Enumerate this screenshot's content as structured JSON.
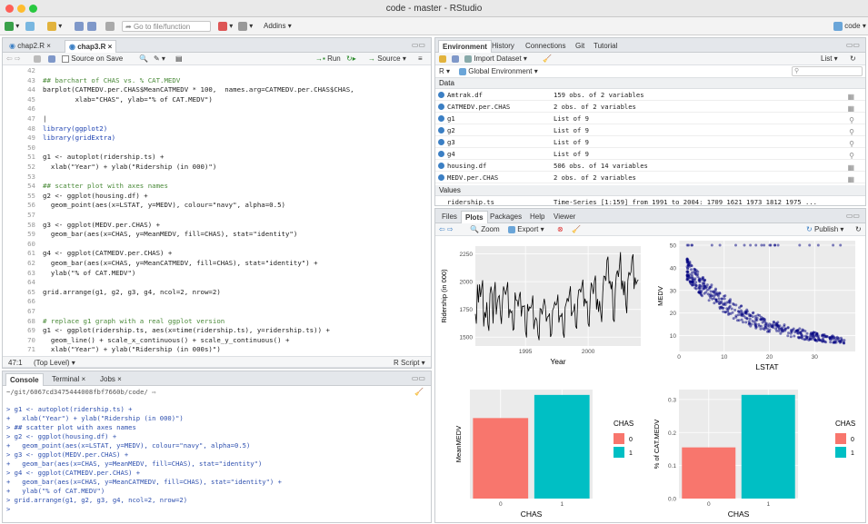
{
  "window": {
    "title": "code - master - RStudio"
  },
  "toolbar": {
    "goto_placeholder": "Go to file/function",
    "addins": "Addins",
    "project": "code"
  },
  "editor": {
    "tabs": [
      "chap2.R",
      "chap3.R"
    ],
    "source_on_save": "Source on Save",
    "run": "Run",
    "source": "Source",
    "status_pos": "47:1",
    "status_level": "(Top Level)",
    "status_type": "R Script",
    "lines": [
      {
        "n": "42",
        "t": ""
      },
      {
        "n": "43",
        "t": "## barchart of CHAS vs. % CAT.MEDV"
      },
      {
        "n": "44",
        "t": "barplot(CATMEDV.per.CHAS$MeanCATMEDV * 100,  names.arg=CATMEDV.per.CHAS$CHAS,"
      },
      {
        "n": "45",
        "t": "        xlab=\"CHAS\", ylab=\"% of CAT.MEDV\")"
      },
      {
        "n": "46",
        "t": ""
      },
      {
        "n": "47",
        "t": "|"
      },
      {
        "n": "48",
        "t": "library(ggplot2)"
      },
      {
        "n": "49",
        "t": "library(gridExtra)"
      },
      {
        "n": "50",
        "t": ""
      },
      {
        "n": "51",
        "t": "g1 <- autoplot(ridership.ts) +"
      },
      {
        "n": "52",
        "t": "  xlab(\"Year\") + ylab(\"Ridership (in 000)\")"
      },
      {
        "n": "53",
        "t": ""
      },
      {
        "n": "54",
        "t": "## scatter plot with axes names"
      },
      {
        "n": "55",
        "t": "g2 <- ggplot(housing.df) +"
      },
      {
        "n": "56",
        "t": "  geom_point(aes(x=LSTAT, y=MEDV), colour=\"navy\", alpha=0.5)"
      },
      {
        "n": "57",
        "t": ""
      },
      {
        "n": "58",
        "t": "g3 <- ggplot(MEDV.per.CHAS) +"
      },
      {
        "n": "59",
        "t": "  geom_bar(aes(x=CHAS, y=MeanMEDV, fill=CHAS), stat=\"identity\")"
      },
      {
        "n": "60",
        "t": ""
      },
      {
        "n": "61",
        "t": "g4 <- ggplot(CATMEDV.per.CHAS) +"
      },
      {
        "n": "62",
        "t": "  geom_bar(aes(x=CHAS, y=MeanCATMEDV, fill=CHAS), stat=\"identity\") +"
      },
      {
        "n": "63",
        "t": "  ylab(\"% of CAT.MEDV\")"
      },
      {
        "n": "64",
        "t": ""
      },
      {
        "n": "65",
        "t": "grid.arrange(g1, g2, g3, g4, ncol=2, nrow=2)"
      },
      {
        "n": "66",
        "t": ""
      },
      {
        "n": "67",
        "t": ""
      },
      {
        "n": "68",
        "t": "# replace g1 graph with a real ggplot version"
      },
      {
        "n": "69",
        "t": "g1 <- ggplot(ridership.ts, aes(x=time(ridership.ts), y=ridership.ts)) +"
      },
      {
        "n": "70",
        "t": "  geom_line() + scale_x_continuous() + scale_y_continuous() +"
      },
      {
        "n": "71",
        "t": "  xlab(\"Year\") + ylab(\"Ridership (in 000s)\")"
      }
    ]
  },
  "console": {
    "tabs": [
      "Console",
      "Terminal",
      "Jobs"
    ],
    "path": "~/git/6067cd3475444008fbf7660b/code/",
    "lines": [
      "> g1 <- autoplot(ridership.ts) +",
      "+   xlab(\"Year\") + ylab(\"Ridership (in 000)\")",
      "> ## scatter plot with axes names",
      "> g2 <- ggplot(housing.df) +",
      "+   geom_point(aes(x=LSTAT, y=MEDV), colour=\"navy\", alpha=0.5)",
      "> g3 <- ggplot(MEDV.per.CHAS) +",
      "+   geom_bar(aes(x=CHAS, y=MeanMEDV, fill=CHAS), stat=\"identity\")",
      "> g4 <- ggplot(CATMEDV.per.CHAS) +",
      "+   geom_bar(aes(x=CHAS, y=MeanCATMEDV, fill=CHAS), stat=\"identity\") +",
      "+   ylab(\"% of CAT.MEDV\")",
      "> grid.arrange(g1, g2, g3, g4, ncol=2, nrow=2)",
      ">"
    ]
  },
  "environment": {
    "tabs": [
      "Environment",
      "History",
      "Connections",
      "Git",
      "Tutorial"
    ],
    "import_dataset": "Import Dataset",
    "list_view": "List",
    "lang": "R",
    "scope": "Global Environment",
    "data_header": "Data",
    "values_header": "Values",
    "rows": [
      {
        "name": "Amtrak.df",
        "value": "159 obs. of 2 variables"
      },
      {
        "name": "CATMEDV.per.CHAS",
        "value": "2 obs. of 2 variables"
      },
      {
        "name": "g1",
        "value": "List of  9"
      },
      {
        "name": "g2",
        "value": "List of  9"
      },
      {
        "name": "g3",
        "value": "List of  9"
      },
      {
        "name": "g4",
        "value": "List of  9"
      },
      {
        "name": "housing.df",
        "value": "506 obs. of 14 variables"
      },
      {
        "name": "MEDV.per.CHAS",
        "value": "2 obs. of 2 variables"
      }
    ],
    "values_row": {
      "name": "ridership.ts",
      "value": "Time-Series [1:159] from 1991 to 2004: 1709 1621 1973 1812 1975 ..."
    }
  },
  "plots_pane": {
    "tabs": [
      "Files",
      "Plots",
      "Packages",
      "Help",
      "Viewer"
    ],
    "zoom": "Zoom",
    "export": "Export",
    "publish": "Publish"
  },
  "colors": {
    "chas0": "#F8766D",
    "chas1": "#00BFC4",
    "navy": "#000080"
  },
  "chart_data": [
    {
      "type": "line",
      "xlabel": "Year",
      "ylabel": "Ridership (in 000)",
      "xlim": [
        1991,
        2004.2
      ],
      "ylim": [
        1420,
        2320
      ],
      "xticks": [
        1995,
        2000
      ],
      "yticks": [
        1500,
        1750,
        2000,
        2250
      ],
      "start": 1991,
      "frequency": 12,
      "values": [
        1709,
        1621,
        1973,
        1812,
        1975,
        1862,
        1940,
        2013,
        1596,
        1725,
        1676,
        1814,
        1615,
        1557,
        1891,
        1956,
        1885,
        1623,
        1903,
        1997,
        1704,
        1810,
        1862,
        1875,
        1705,
        1619,
        1837,
        1957,
        1917,
        1882,
        1933,
        1996,
        1673,
        1753,
        1720,
        1734,
        1563,
        1574,
        1903,
        1834,
        1831,
        1776,
        1868,
        1907,
        1686,
        1779,
        1776,
        1783,
        1548,
        1497,
        1798,
        1733,
        1772,
        1761,
        1792,
        1875,
        1571,
        1647,
        1673,
        1646,
        1521,
        1472,
        1758,
        1751,
        1704,
        1785,
        1846,
        1779,
        1640,
        1682,
        1688,
        1713,
        1502,
        1528,
        1742,
        1765,
        1814,
        1788,
        1799,
        1883,
        1631,
        1693,
        1686,
        1716,
        1538,
        1495,
        1769,
        1807,
        1851,
        1819,
        1889,
        1958,
        1690,
        1723,
        1737,
        1801,
        1600,
        1576,
        1834,
        1923,
        1931,
        1903,
        1964,
        2018,
        1777,
        1847,
        1809,
        1822,
        1620,
        1594,
        1862,
        1990,
        1957,
        1889,
        2005,
        2054,
        1749,
        1844,
        1727,
        1826,
        1721,
        1636,
        1904,
        2050,
        2047,
        2007,
        2193,
        2225,
        1982,
        2006,
        1932,
        2001,
        1660,
        1638,
        1931,
        2064,
        2101,
        2042,
        2143,
        2266,
        1931,
        2010,
        1877,
        2003,
        1800,
        1715,
        2011,
        2086,
        2059,
        2086,
        2209,
        2246,
        1934,
        2037,
        1979,
        2003,
        2018
      ]
    },
    {
      "type": "scatter",
      "xlabel": "LSTAT",
      "ylabel": "MEDV",
      "xlim": [
        0,
        39
      ],
      "ylim": [
        3,
        52
      ],
      "xticks": [
        0,
        10,
        20,
        30
      ],
      "yticks": [
        10,
        20,
        30,
        40,
        50
      ],
      "point_count": 506
    },
    {
      "type": "bar",
      "xlabel": "CHAS",
      "ylabel": "MeanMEDV",
      "categories": [
        "0",
        "1"
      ],
      "values": [
        22.09,
        28.44
      ],
      "ylim": [
        0,
        29.9
      ],
      "legend": {
        "title": "CHAS",
        "entries": [
          "0",
          "1"
        ],
        "position": "right"
      }
    },
    {
      "type": "bar",
      "xlabel": "CHAS",
      "ylabel": "% of CAT.MEDV",
      "categories": [
        "0",
        "1"
      ],
      "values": [
        0.155,
        0.314
      ],
      "ylim": [
        0,
        0.33
      ],
      "yticks": [
        0.0,
        0.1,
        0.2,
        0.3
      ],
      "legend": {
        "title": "CHAS",
        "entries": [
          "0",
          "1"
        ],
        "position": "right"
      }
    }
  ]
}
